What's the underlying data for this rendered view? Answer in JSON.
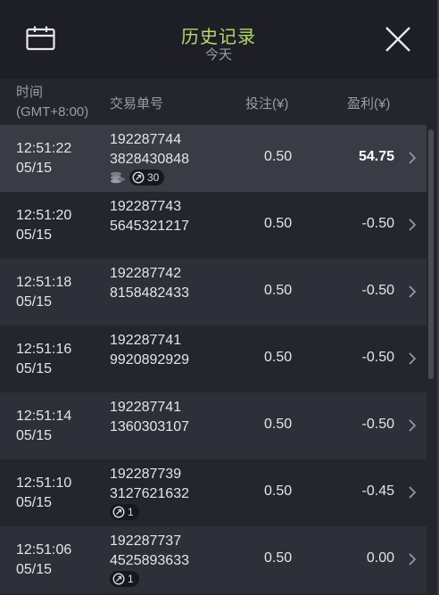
{
  "header": {
    "title": "历史记录",
    "subtitle": "今天"
  },
  "columns": {
    "time_line1": "时间",
    "time_line2": "(GMT+8:00)",
    "order": "交易单号",
    "bet": "投注(¥)",
    "profit": "盈利(¥)"
  },
  "rows": [
    {
      "time": "12:51:22",
      "date": "05/15",
      "order1": "192287744",
      "order2": "3828430848",
      "bet": "0.50",
      "profit": "54.75",
      "coin_icon": true,
      "pill": "30"
    },
    {
      "time": "12:51:20",
      "date": "05/15",
      "order1": "192287743",
      "order2": "5645321217",
      "bet": "0.50",
      "profit": "-0.50"
    },
    {
      "time": "12:51:18",
      "date": "05/15",
      "order1": "192287742",
      "order2": "8158482433",
      "bet": "0.50",
      "profit": "-0.50"
    },
    {
      "time": "12:51:16",
      "date": "05/15",
      "order1": "192287741",
      "order2": "9920892929",
      "bet": "0.50",
      "profit": "-0.50"
    },
    {
      "time": "12:51:14",
      "date": "05/15",
      "order1": "192287741",
      "order2": "1360303107",
      "bet": "0.50",
      "profit": "-0.50"
    },
    {
      "time": "12:51:10",
      "date": "05/15",
      "order1": "192287739",
      "order2": "3127621632",
      "bet": "0.50",
      "profit": "-0.45",
      "pill": "1"
    },
    {
      "time": "12:51:06",
      "date": "05/15",
      "order1": "192287737",
      "order2": "4525893633",
      "bet": "0.50",
      "profit": "0.00",
      "pill": "1"
    }
  ],
  "colors": {
    "title": "#b6d96a",
    "background": "#24262e"
  }
}
